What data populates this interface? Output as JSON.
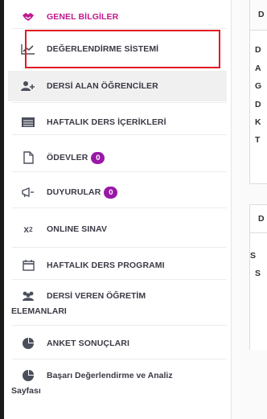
{
  "menu": {
    "items": [
      {
        "label": "GENEL BİLGİLER",
        "icon": "handshake-icon"
      },
      {
        "label": "DEĞERLENDİRME SİSTEMİ",
        "icon": "line-chart-icon"
      },
      {
        "label": "DERSİ ALAN ÖĞRENCİLER",
        "icon": "add-user-icon"
      },
      {
        "label": "HAFTALIK DERS İÇERİKLERİ",
        "icon": "list-icon"
      },
      {
        "label": "ÖDEVLER",
        "icon": "file-icon",
        "badge": "0"
      },
      {
        "label": "DUYURULAR",
        "icon": "bullhorn-icon",
        "badge": "0"
      },
      {
        "label": "ONLINE SINAV",
        "icon": "superscript-icon"
      },
      {
        "label": "HAFTALIK DERS PROGRAMI",
        "icon": "calendar-icon"
      },
      {
        "label_line1": "DERSİ VEREN ÖĞRETİM",
        "label_line2": "ELEMANLARI",
        "icon": "users-icon"
      },
      {
        "label": "ANKET SONUÇLARI",
        "icon": "pie-chart-icon"
      },
      {
        "label_line1": "Başarı Değerlendirme ve Analiz",
        "label_line2": "Sayfası",
        "icon": "pie-chart-icon"
      }
    ]
  },
  "right_panel": {
    "panel1_header": "D",
    "panel1_rows": [
      "D",
      "A",
      "G",
      "D",
      "K",
      "T"
    ],
    "panel2_header": "D",
    "panel2_rows": [
      "S",
      "S"
    ]
  },
  "colors": {
    "active": "#c2188f",
    "badge": "#9a17a8",
    "highlight_box": "#e01b24"
  }
}
